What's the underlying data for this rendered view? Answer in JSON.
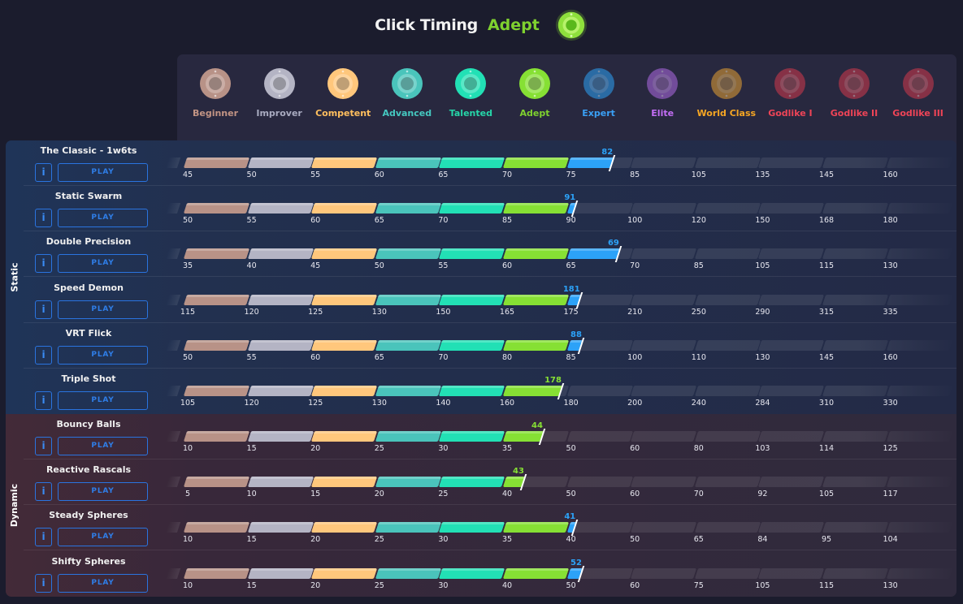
{
  "header": {
    "title": "Click Timing",
    "rank": "Adept",
    "rank_color": "#7fd12f",
    "rank_badge_icon": "adept-badge-icon"
  },
  "ranks": [
    {
      "label": "Beginner",
      "color": "#c29484",
      "bar": "#b89287",
      "icon": "beginner-badge-icon"
    },
    {
      "label": "Improver",
      "color": "#a9abc0",
      "bar": "#b4b4c4",
      "icon": "improver-badge-icon"
    },
    {
      "label": "Competent",
      "color": "#ffbf5e",
      "bar": "#ffc77c",
      "icon": "competent-badge-icon"
    },
    {
      "label": "Advanced",
      "color": "#45c8c0",
      "bar": "#4ac4bb",
      "icon": "advanced-badge-icon"
    },
    {
      "label": "Talented",
      "color": "#26d6a9",
      "bar": "#22e0b5",
      "icon": "talented-badge-icon"
    },
    {
      "label": "Adept",
      "color": "#7fd12f",
      "bar": "#86e034",
      "icon": "adept-badge-icon"
    },
    {
      "label": "Expert",
      "color": "#3aa0f5",
      "bar": "#2ca2f8",
      "icon": "expert-badge-icon"
    },
    {
      "label": "Elite",
      "color": "#c46ef6",
      "bar": "#b06ae6",
      "icon": "elite-badge-icon"
    },
    {
      "label": "World Class",
      "color": "#f6a623",
      "bar": "#e6a033",
      "icon": "world-class-badge-icon"
    },
    {
      "label": "Godlike I",
      "color": "#ef4457",
      "bar": "#d43a4d",
      "icon": "godlike-1-badge-icon"
    },
    {
      "label": "Godlike II",
      "color": "#ef4457",
      "bar": "#d43a4d",
      "icon": "godlike-2-badge-icon"
    },
    {
      "label": "Godlike III",
      "color": "#ef4457",
      "bar": "#d43a4d",
      "icon": "godlike-3-badge-icon"
    }
  ],
  "buttons": {
    "info": "i",
    "play": "PLAY"
  },
  "groups": [
    {
      "label": "Static",
      "scenarios": [
        {
          "name": "The Classic - 1w6ts",
          "score": 82,
          "thresholds": [
            45,
            50,
            55,
            60,
            65,
            70,
            75,
            85,
            105,
            135,
            145,
            160
          ]
        },
        {
          "name": "Static Swarm",
          "score": 91,
          "thresholds": [
            50,
            55,
            60,
            65,
            70,
            85,
            90,
            100,
            120,
            150,
            168,
            180
          ]
        },
        {
          "name": "Double Precision",
          "score": 69,
          "thresholds": [
            35,
            40,
            45,
            50,
            55,
            60,
            65,
            70,
            85,
            105,
            115,
            130
          ]
        },
        {
          "name": "Speed Demon",
          "score": 181,
          "thresholds": [
            115,
            120,
            125,
            130,
            150,
            165,
            175,
            210,
            250,
            290,
            315,
            335
          ]
        },
        {
          "name": "VRT Flick",
          "score": 88,
          "thresholds": [
            50,
            55,
            60,
            65,
            70,
            80,
            85,
            100,
            110,
            130,
            145,
            160
          ]
        },
        {
          "name": "Triple Shot",
          "score": 178,
          "thresholds": [
            105,
            120,
            125,
            130,
            140,
            160,
            180,
            200,
            240,
            284,
            310,
            330
          ]
        }
      ]
    },
    {
      "label": "Dynamic",
      "scenarios": [
        {
          "name": "Bouncy Balls",
          "score": 44,
          "thresholds": [
            10,
            15,
            20,
            25,
            30,
            35,
            50,
            60,
            80,
            103,
            114,
            125
          ]
        },
        {
          "name": "Reactive Rascals",
          "score": 43,
          "thresholds": [
            5,
            10,
            15,
            20,
            25,
            40,
            50,
            60,
            70,
            92,
            105,
            117
          ]
        },
        {
          "name": "Steady Spheres",
          "score": 41,
          "thresholds": [
            10,
            15,
            20,
            25,
            30,
            35,
            40,
            50,
            65,
            84,
            95,
            104
          ]
        },
        {
          "name": "Shifty Spheres",
          "score": 52,
          "thresholds": [
            10,
            15,
            20,
            25,
            30,
            40,
            50,
            60,
            75,
            105,
            115,
            130
          ]
        }
      ]
    }
  ]
}
